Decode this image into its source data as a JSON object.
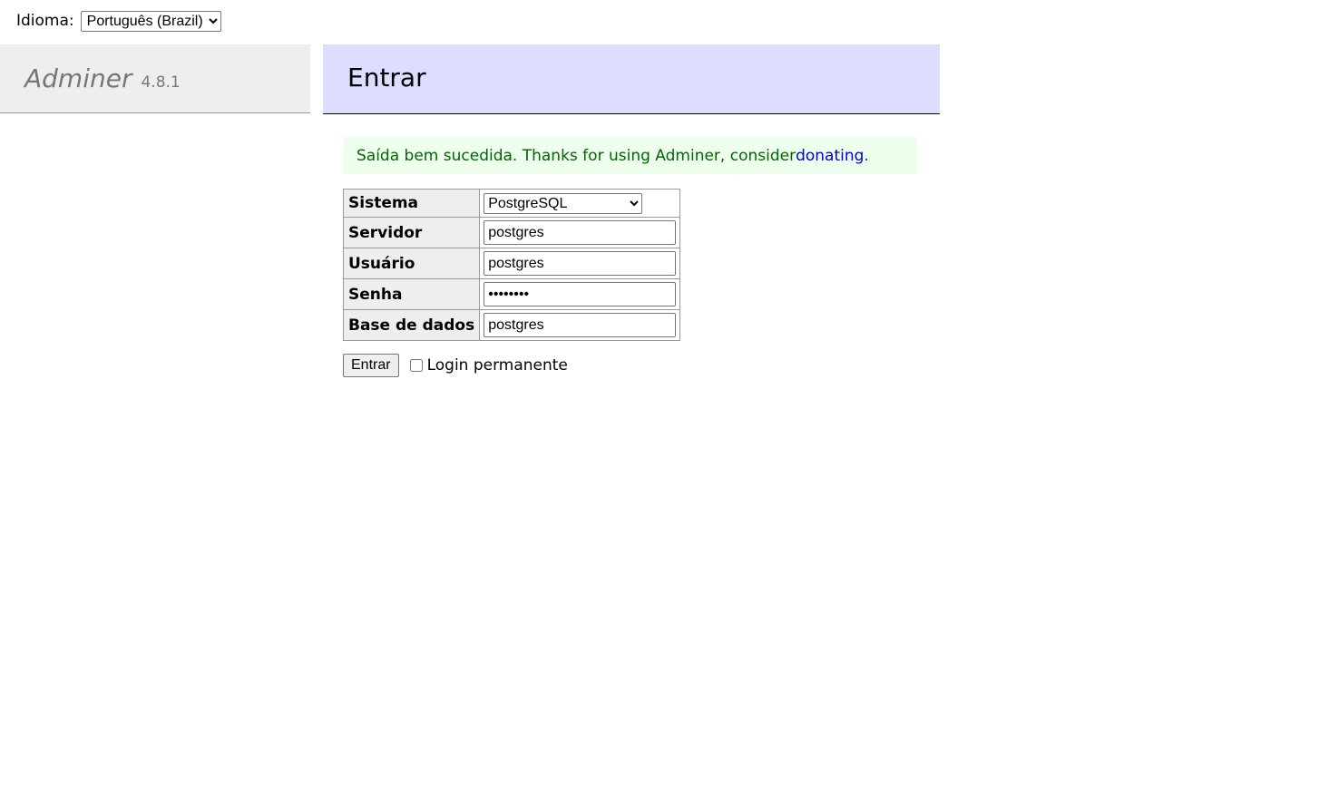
{
  "language": {
    "label": "Idioma:",
    "selected": "Português (Brazil)"
  },
  "brand": {
    "name": "Adminer",
    "version": "4.8.1"
  },
  "page": {
    "title": "Entrar"
  },
  "message": {
    "text": "Saída bem sucedida. Thanks for using Adminer, consider ",
    "link": "donating",
    "suffix": "."
  },
  "form": {
    "system_label": "Sistema",
    "system_value": "PostgreSQL",
    "server_label": "Servidor",
    "server_value": "postgres",
    "user_label": "Usuário",
    "user_value": "postgres",
    "password_label": "Senha",
    "password_value": "postgres",
    "database_label": "Base de dados",
    "database_value": "postgres"
  },
  "actions": {
    "submit_label": "Entrar",
    "permanent_label": "Login permanente"
  }
}
